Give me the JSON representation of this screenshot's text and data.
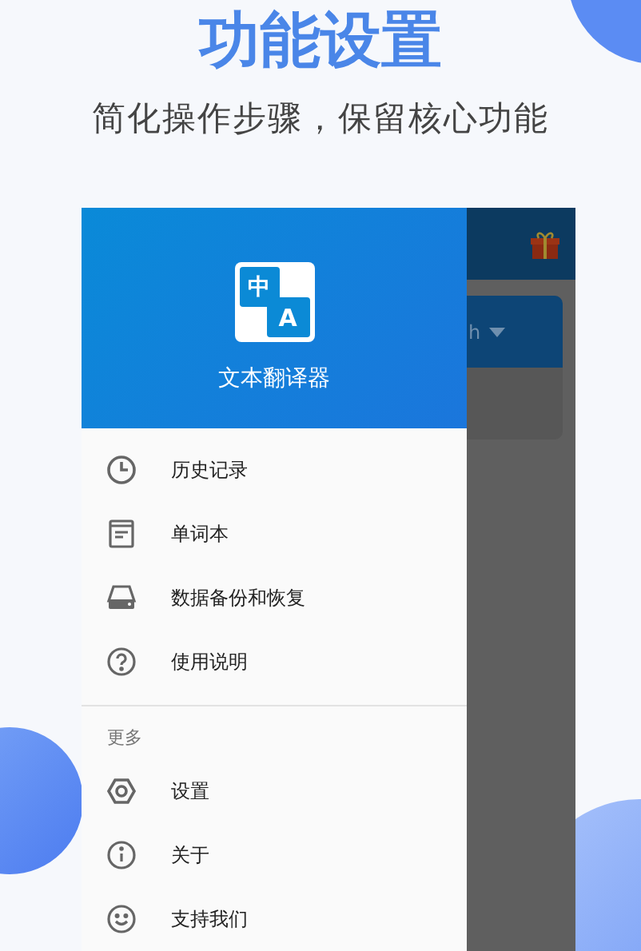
{
  "heading": {
    "title": "功能设置",
    "subtitle": "简化操作步骤，保留核心功能"
  },
  "background_card": {
    "text": "h"
  },
  "drawer": {
    "logo": {
      "zh": "中",
      "latin": "A"
    },
    "app_name": "文本翻译器",
    "items": [
      {
        "kind": "history",
        "label": "历史记录"
      },
      {
        "kind": "wordbook",
        "label": "单词本"
      },
      {
        "kind": "backup",
        "label": "数据备份和恢复"
      },
      {
        "kind": "help",
        "label": "使用说明"
      }
    ],
    "section_title": "更多",
    "more_items": [
      {
        "kind": "settings",
        "label": "设置"
      },
      {
        "kind": "about",
        "label": "关于"
      },
      {
        "kind": "support",
        "label": "支持我们"
      }
    ]
  }
}
